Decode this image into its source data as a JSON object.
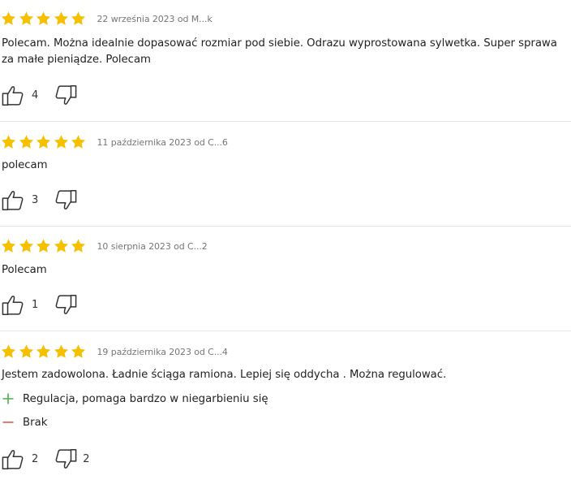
{
  "colors": {
    "star": "#f5c000",
    "plus": "#4caf50",
    "minus": "#e05a45",
    "meta_text": "#767676",
    "separator": "#e4e4e4"
  },
  "reviews": [
    {
      "rating": 5,
      "meta": "22 września 2023 od M...k",
      "text": "Polecam. Można idealnie dopasować rozmiar pod siebie. Odrazu wyprostowana sylwetka. Super sprawa za małe pieniądze. Polecam",
      "likes": "4",
      "dislikes": ""
    },
    {
      "rating": 5,
      "meta": "11 października 2023 od C...6",
      "text": "polecam",
      "likes": "3",
      "dislikes": ""
    },
    {
      "rating": 5,
      "meta": "10 sierpnia 2023 od C...2",
      "text": "Polecam",
      "likes": "1",
      "dislikes": ""
    },
    {
      "rating": 5,
      "meta": "19 października 2023 od C...4",
      "text": "Jestem zadowolona. Ładnie ściąga ramiona. Lepiej się oddycha . Można regulować.",
      "pros": "Regulacja, pomaga bardzo w niegarbieniu się",
      "cons": "Brak",
      "likes": "2",
      "dislikes": "2"
    }
  ],
  "icons": {
    "star": "star-icon",
    "thumb_up": "thumbs-up-icon",
    "thumb_down": "thumbs-down-icon",
    "plus": "plus-icon",
    "minus": "minus-icon"
  }
}
